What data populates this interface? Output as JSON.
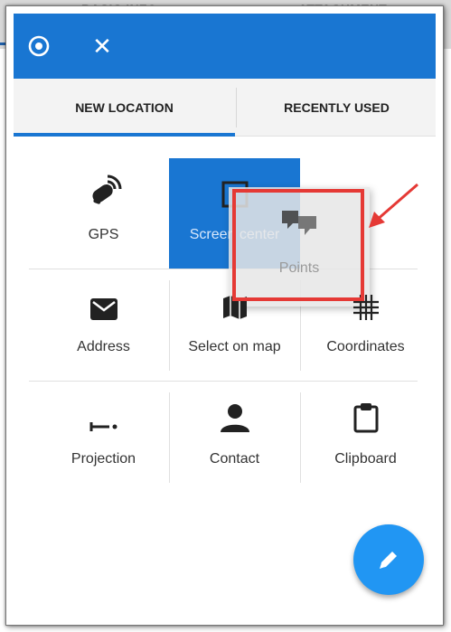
{
  "background": {
    "tabs": [
      "BASIC INFO",
      "ATTACHMENT"
    ]
  },
  "toolbar": {
    "left_icon": "target-icon",
    "close_icon": "close-icon",
    "close_glyph": "✕"
  },
  "tabs": [
    {
      "label": "NEW LOCATION",
      "active": true
    },
    {
      "label": "RECENTLY USED",
      "active": false
    }
  ],
  "grid": {
    "row1": [
      {
        "label": "GPS",
        "icon": "satellite-icon"
      },
      {
        "label": "Screen center",
        "icon": "screen-center-icon",
        "selected": true
      }
    ],
    "row2": [
      {
        "label": "Address",
        "icon": "envelope-icon"
      },
      {
        "label": "Select on map",
        "icon": "map-icon"
      },
      {
        "label": "Coordinates",
        "icon": "grid-icon"
      }
    ],
    "row3": [
      {
        "label": "Projection",
        "icon": "projection-icon"
      },
      {
        "label": "Contact",
        "icon": "person-icon"
      },
      {
        "label": "Clipboard",
        "icon": "clipboard-icon"
      }
    ]
  },
  "drag_item": {
    "label": "Points",
    "icon": "points-icon"
  },
  "annotation": {
    "highlight_color": "#e53935",
    "arrow_color": "#e53935"
  },
  "fab": {
    "icon": "pencil-icon"
  },
  "colors": {
    "primary": "#1976d2",
    "fab": "#2196f3"
  }
}
